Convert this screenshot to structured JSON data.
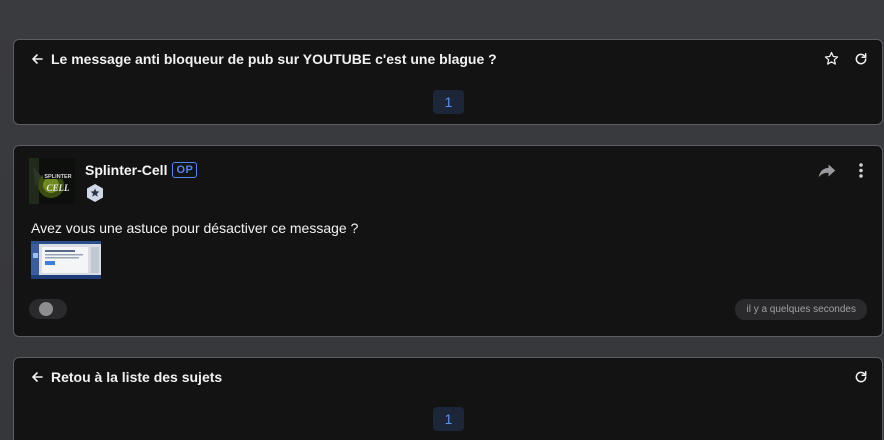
{
  "topic": {
    "title": "Le message anti bloqueur de pub sur YOUTUBE c'est une blague ?",
    "page": "1",
    "icons": [
      "back-arrow-icon",
      "star-icon",
      "refresh-icon"
    ]
  },
  "post": {
    "author": "Splinter-Cell",
    "op_label": "OP",
    "message": "Avez vous une astuce pour désactiver ce message ?",
    "timestamp": "il y a quelques secondes",
    "avatar_text": "SPLINTER CELL",
    "icons": [
      "star-rank-icon",
      "share-icon",
      "more-vertical-icon"
    ]
  },
  "footer": {
    "title": "Retou à la liste des sujets",
    "page": "1",
    "icons": [
      "back-arrow-icon",
      "refresh-icon"
    ]
  },
  "colors": {
    "background": "#37383c",
    "card": "#131314",
    "accent": "#4f86f2"
  }
}
